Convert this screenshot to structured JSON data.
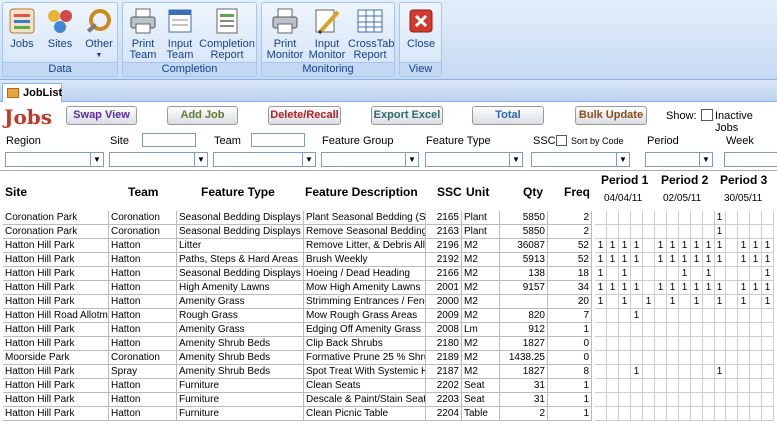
{
  "ribbon": {
    "groups": [
      {
        "label": "Data",
        "buttons": [
          {
            "label": "Jobs",
            "icon": "jobs-icon"
          },
          {
            "label": "Sites",
            "icon": "sites-icon"
          },
          {
            "label": "Other",
            "icon": "other-icon"
          }
        ]
      },
      {
        "label": "Completion",
        "buttons": [
          {
            "label": "Print Team",
            "icon": "print-icon"
          },
          {
            "label": "Input Team",
            "icon": "input-icon"
          },
          {
            "label": "Completion Report",
            "icon": "report-icon"
          }
        ]
      },
      {
        "label": "Monitoring",
        "buttons": [
          {
            "label": "Print Monitor",
            "icon": "print-icon"
          },
          {
            "label": "Input Monitor",
            "icon": "pencil-icon"
          },
          {
            "label": "CrossTab Report",
            "icon": "grid-icon"
          }
        ]
      },
      {
        "label": "View",
        "buttons": [
          {
            "label": "Close",
            "icon": "close-icon"
          }
        ]
      }
    ]
  },
  "tab": {
    "label": "JobList"
  },
  "form": {
    "title": "Jobs",
    "buttons": {
      "swap": "Swap View",
      "add": "Add Job",
      "delete": "Delete/Recall",
      "export": "Export Excel",
      "total": "Total",
      "bulk": "Bulk Update"
    },
    "show_label": "Show:",
    "inactive_label": "Inactive Jobs",
    "filters": {
      "region": "Region",
      "site": "Site",
      "team": "Team",
      "feature_group": "Feature Group",
      "feature_type": "Feature Type",
      "ssc": "SSC",
      "sort_by_code": "Sort by Code",
      "period": "Period",
      "week": "Week"
    }
  },
  "grid": {
    "headers": {
      "site": "Site",
      "team": "Team",
      "feature_type": "Feature Type",
      "feature_description": "Feature Description",
      "ssc": "SSC",
      "unit": "Unit",
      "qty": "Qty",
      "freq": "Freq"
    },
    "periods": [
      {
        "label": "Period 1",
        "date": "04/04/11"
      },
      {
        "label": "Period 2",
        "date": "02/05/11"
      },
      {
        "label": "Period 3",
        "date": "30/05/11"
      }
    ],
    "rows": [
      {
        "site": "Coronation Park",
        "team": "Coronation",
        "ftype": "Seasonal Bedding Displays",
        "fdesc": "Plant Seasonal Bedding (Spri",
        "ssc": "2165",
        "unit": "Plant",
        "qty": "5850",
        "freq": "2",
        "p": [
          "",
          "",
          "",
          "",
          "",
          "",
          "",
          "",
          "",
          "",
          "1",
          "",
          "",
          "",
          "",
          ""
        ]
      },
      {
        "site": "Coronation Park",
        "team": "Coronation",
        "ftype": "Seasonal Bedding Displays",
        "fdesc": "Remove Seasonal Bedding Pl",
        "ssc": "2163",
        "unit": "Plant",
        "qty": "5850",
        "freq": "2",
        "p": [
          "",
          "",
          "",
          "",
          "",
          "",
          "",
          "",
          "",
          "",
          "1",
          "",
          "",
          "",
          "",
          ""
        ]
      },
      {
        "site": "Hatton Hill Park",
        "team": "Hatton",
        "ftype": "Litter",
        "fdesc": "Remove Litter, & Debris All A",
        "ssc": "2196",
        "unit": "M2",
        "qty": "36087",
        "freq": "52",
        "p": [
          "1",
          "1",
          "1",
          "1",
          "",
          "1",
          "1",
          "1",
          "1",
          "1",
          "1",
          "",
          "1",
          "1",
          "1",
          "1"
        ]
      },
      {
        "site": "Hatton Hill Park",
        "team": "Hatton",
        "ftype": "Paths, Steps & Hard Areas",
        "fdesc": "Brush Weekly",
        "ssc": "2192",
        "unit": "M2",
        "qty": "5913",
        "freq": "52",
        "p": [
          "1",
          "1",
          "1",
          "1",
          "",
          "1",
          "1",
          "1",
          "1",
          "1",
          "1",
          "",
          "1",
          "1",
          "1",
          "1"
        ]
      },
      {
        "site": "Hatton Hill Park",
        "team": "Hatton",
        "ftype": "Seasonal Bedding Displays",
        "fdesc": "Hoeing / Dead Heading",
        "ssc": "2166",
        "unit": "M2",
        "qty": "138",
        "freq": "18",
        "p": [
          "1",
          "",
          "1",
          "",
          "",
          "",
          "",
          "1",
          "",
          "1",
          "",
          "",
          "",
          "",
          "1",
          ""
        ]
      },
      {
        "site": "Hatton Hill Park",
        "team": "Hatton",
        "ftype": "High Amenity Lawns",
        "fdesc": "Mow High Amenity Lawns",
        "ssc": "2001",
        "unit": "M2",
        "qty": "9157",
        "freq": "34",
        "p": [
          "1",
          "1",
          "1",
          "1",
          "",
          "1",
          "1",
          "1",
          "1",
          "1",
          "1",
          "",
          "1",
          "1",
          "1",
          "1"
        ]
      },
      {
        "site": "Hatton Hill Park",
        "team": "Hatton",
        "ftype": "Amenity Grass",
        "fdesc": "Strimming Entrances / Fence",
        "ssc": "2000",
        "unit": "M2",
        "qty": "",
        "freq": "20",
        "p": [
          "1",
          "",
          "1",
          "",
          "1",
          "",
          "1",
          "",
          "1",
          "",
          "1",
          "",
          "1",
          "",
          "1",
          ""
        ]
      },
      {
        "site": "Hatton Hill Road Allotmen",
        "team": "Hatton",
        "ftype": "Rough Grass",
        "fdesc": "Mow Rough Grass Areas",
        "ssc": "2009",
        "unit": "M2",
        "qty": "820",
        "freq": "7",
        "p": [
          "",
          "",
          "",
          "1",
          "",
          "",
          "",
          "",
          "",
          "",
          "",
          "",
          "",
          "",
          "",
          ""
        ]
      },
      {
        "site": "Hatton Hill Park",
        "team": "Hatton",
        "ftype": "Amenity Grass",
        "fdesc": "Edging Off Amenity Grass",
        "ssc": "2008",
        "unit": "Lm",
        "qty": "912",
        "freq": "1",
        "p": [
          "",
          "",
          "",
          "",
          "",
          "",
          "",
          "",
          "",
          "",
          "",
          "",
          "",
          "",
          "",
          ""
        ]
      },
      {
        "site": "Hatton Hill Park",
        "team": "Hatton",
        "ftype": "Amenity Shrub Beds",
        "fdesc": "Clip Back Shrubs",
        "ssc": "2180",
        "unit": "M2",
        "qty": "1827",
        "freq": "0",
        "p": [
          "",
          "",
          "",
          "",
          "",
          "",
          "",
          "",
          "",
          "",
          "",
          "",
          "",
          "",
          "",
          ""
        ]
      },
      {
        "site": "Moorside Park",
        "team": "Coronation",
        "ftype": "Amenity Shrub Beds",
        "fdesc": "Formative Prune 25 % Shrubs",
        "ssc": "2189",
        "unit": "M2",
        "qty": "1438.25",
        "freq": "0",
        "p": [
          "",
          "",
          "",
          "",
          "",
          "",
          "",
          "",
          "",
          "",
          "",
          "",
          "",
          "",
          "",
          ""
        ]
      },
      {
        "site": "Hatton Hill Park",
        "team": "Spray",
        "ftype": "Amenity Shrub Beds",
        "fdesc": "Spot Treat With Systemic He",
        "ssc": "2187",
        "unit": "M2",
        "qty": "1827",
        "freq": "8",
        "p": [
          "",
          "",
          "",
          "1",
          "",
          "",
          "",
          "",
          "",
          "",
          "1",
          "",
          "",
          "",
          "",
          "1"
        ]
      },
      {
        "site": "Hatton Hill Park",
        "team": "Hatton",
        "ftype": "Furniture",
        "fdesc": "Clean Seats",
        "ssc": "2202",
        "unit": "Seat",
        "qty": "31",
        "freq": "1",
        "p": [
          "",
          "",
          "",
          "",
          "",
          "",
          "",
          "",
          "",
          "",
          "",
          "",
          "",
          "",
          "",
          ""
        ]
      },
      {
        "site": "Hatton Hill Park",
        "team": "Hatton",
        "ftype": "Furniture",
        "fdesc": "Descale & Paint/Stain Seats",
        "ssc": "2203",
        "unit": "Seat",
        "qty": "31",
        "freq": "1",
        "p": [
          "",
          "",
          "",
          "",
          "",
          "",
          "",
          "",
          "",
          "",
          "",
          "",
          "",
          "",
          "",
          ""
        ]
      },
      {
        "site": "Hatton Hill Park",
        "team": "Hatton",
        "ftype": "Furniture",
        "fdesc": "Clean Picnic Table",
        "ssc": "2204",
        "unit": "Table",
        "qty": "2",
        "freq": "1",
        "p": [
          "",
          "",
          "",
          "",
          "",
          "",
          "",
          "",
          "",
          "",
          "",
          "",
          "",
          "",
          "",
          ""
        ]
      }
    ]
  }
}
